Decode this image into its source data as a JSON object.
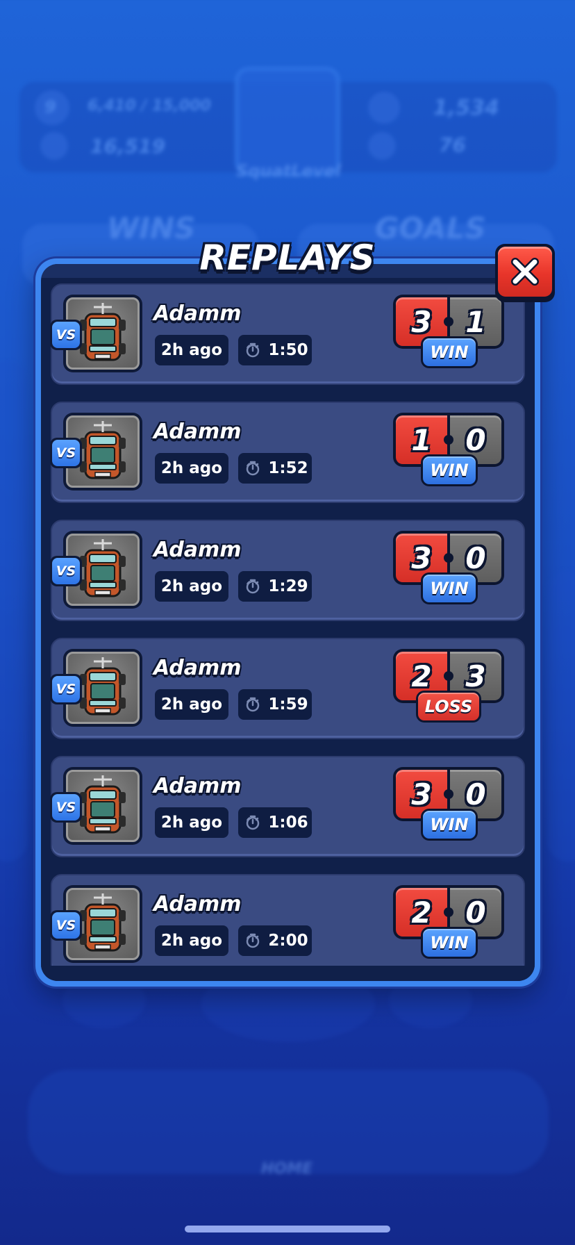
{
  "background": {
    "level": "9",
    "xp_text": "6,410 / 15,000",
    "coins": "16,519",
    "trophies": "1,534",
    "gems": "76",
    "username": "SquatLevel",
    "wins_label": "WINS",
    "goals_label": "GOALS",
    "home_label": "HOME"
  },
  "modal": {
    "title": "REPLAYS"
  },
  "colors": {
    "win": "#2d6fe0",
    "loss": "#d4302a",
    "player_score": "#d62f27",
    "opponent_score": "#5e5e5e"
  },
  "replays": [
    {
      "vs": "VS",
      "opponent": "Adamm",
      "time_ago": "2h ago",
      "duration": "1:50",
      "score_left": "3",
      "score_right": "1",
      "result": "WIN"
    },
    {
      "vs": "VS",
      "opponent": "Adamm",
      "time_ago": "2h ago",
      "duration": "1:52",
      "score_left": "1",
      "score_right": "0",
      "result": "WIN"
    },
    {
      "vs": "VS",
      "opponent": "Adamm",
      "time_ago": "2h ago",
      "duration": "1:29",
      "score_left": "3",
      "score_right": "0",
      "result": "WIN"
    },
    {
      "vs": "VS",
      "opponent": "Adamm",
      "time_ago": "2h ago",
      "duration": "1:59",
      "score_left": "2",
      "score_right": "3",
      "result": "LOSS"
    },
    {
      "vs": "VS",
      "opponent": "Adamm",
      "time_ago": "2h ago",
      "duration": "1:06",
      "score_left": "3",
      "score_right": "0",
      "result": "WIN"
    },
    {
      "vs": "VS",
      "opponent": "Adamm",
      "time_ago": "2h ago",
      "duration": "2:00",
      "score_left": "2",
      "score_right": "0",
      "result": "WIN"
    }
  ]
}
